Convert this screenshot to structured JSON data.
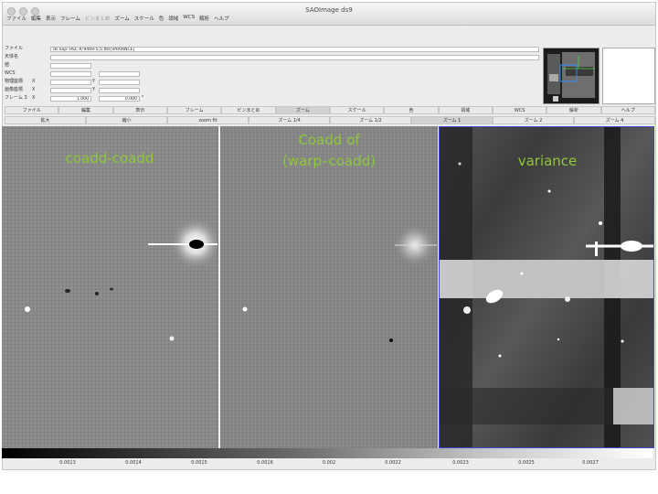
{
  "window": {
    "title": "SAOImage ds9"
  },
  "menu": [
    "ファイル",
    "編集",
    "表示",
    "フレーム",
    "ビンまとめ",
    "ズーム",
    "スケール",
    "色",
    "領域",
    "WCS",
    "解析",
    "ヘルプ"
  ],
  "info": {
    "file_label": "ファイル",
    "file_value": "ds.exp–HSC-R-9469-5,5.fits[VARIANCE]",
    "object_label": "天体名",
    "value_label": "値",
    "wcs_label": "WCS",
    "physical_label": "物理座標",
    "image_label": "画像座標",
    "frame_label": "フレーム 3",
    "x_label": "X",
    "y_label": "Y",
    "zoom_value": "1.000",
    "angle_value": "0.000",
    "degree_symbol": "°"
  },
  "buttonbar": [
    "ファイル",
    "編集",
    "表示",
    "フレーム",
    "ビンまとめ",
    "ズーム",
    "スケール",
    "色",
    "領域",
    "WCS",
    "解析",
    "ヘルプ"
  ],
  "buttonbar_selected": 5,
  "zoombar": [
    "拡大",
    "縮小",
    "zoom fit",
    "ズーム 1/4",
    "ズーム 1/2",
    "ズーム 1",
    "ズーム 2",
    "ズーム 4"
  ],
  "zoombar_selected": 5,
  "frames": [
    {
      "label": "coadd-coadd",
      "background": "#8a8a8a"
    },
    {
      "label": "Coadd of\n(warp–coadd)",
      "background": "#858585"
    },
    {
      "label": "variance",
      "background": "#3a3a3a"
    }
  ],
  "colorbar_ticks": [
    "0.0013",
    "0.0014",
    "0.0015",
    "0.0016",
    "0.002",
    "0.0022",
    "0.0023",
    "0.0025",
    "0.0027"
  ],
  "colors": {
    "label_green": "#8ec73a",
    "frame_highlight": "#3d49c9"
  }
}
